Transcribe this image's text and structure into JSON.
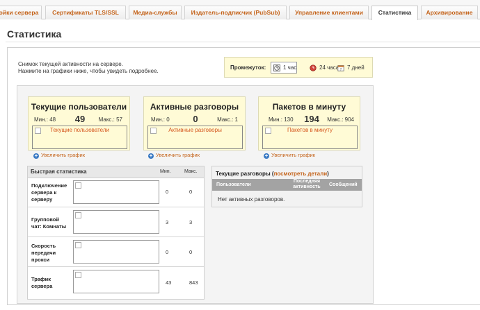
{
  "tabs": [
    {
      "label": "ойки сервера",
      "active": false
    },
    {
      "label": "Сертификаты TLS/SSL",
      "active": false
    },
    {
      "label": "Медиа-службы",
      "active": false
    },
    {
      "label": "Издатель-подписчик (PubSub)",
      "active": false
    },
    {
      "label": "Управление клиентами",
      "active": false
    },
    {
      "label": "Статистика",
      "active": true
    },
    {
      "label": "Архивирование",
      "active": false
    }
  ],
  "page_title": "Статистика",
  "snapshot": {
    "line1": "Снимок текущей активности на сервере.",
    "line2": "Нажмите на графики ниже, чтобы увидеть подробнее."
  },
  "range": {
    "label": "Промежуток:",
    "options": [
      {
        "label": "1 час",
        "icon": "clock-icon",
        "selected": true
      },
      {
        "label": "24 часа",
        "icon": "red-clock-icon",
        "selected": false
      },
      {
        "label": "7 дней",
        "icon": "calendar-icon",
        "selected": false
      }
    ]
  },
  "cards": [
    {
      "title": "Текущие пользователи",
      "min": "Мин.: 48",
      "value": "49",
      "max": "Макс.: 57",
      "graph_alt": "Текущие пользователи",
      "enlarge": "Увеличить график"
    },
    {
      "title": "Активные разговоры",
      "min": "Мин.: 0",
      "value": "0",
      "max": "Макс.: 1",
      "graph_alt": "Активные разговоры",
      "enlarge": "Увеличить график"
    },
    {
      "title": "Пакетов в минуту",
      "min": "Мин.: 130",
      "value": "194",
      "max": "Макс.: 904",
      "graph_alt": "Пакетов в минуту",
      "enlarge": "Увеличить график"
    }
  ],
  "quick_stats": {
    "title": "Быстрая статистика",
    "col_min": "Мин.",
    "col_max": "Макс.",
    "rows": [
      {
        "label": "Подключение сервера к серверу",
        "min": "0",
        "max": "0"
      },
      {
        "label": "Групповой чат: Комнаты",
        "min": "3",
        "max": "3"
      },
      {
        "label": "Скорость передачи прокси",
        "min": "0",
        "max": "0"
      },
      {
        "label": "Трафик сервера",
        "min": "43",
        "max": "843"
      }
    ]
  },
  "conversations": {
    "title": "Текущие разговоры",
    "link_open": " (",
    "link": "посмотреть детали",
    "link_close": ")",
    "col_users": "Пользователи",
    "col_activity_1": "Последняя",
    "col_activity_2": "активность",
    "col_messages": "Сообщений",
    "empty": "Нет активных разговоров."
  },
  "colors": {
    "accent": "#c4631a",
    "highlight_bg": "#fffbd6",
    "graph_label": "#d4541b"
  }
}
